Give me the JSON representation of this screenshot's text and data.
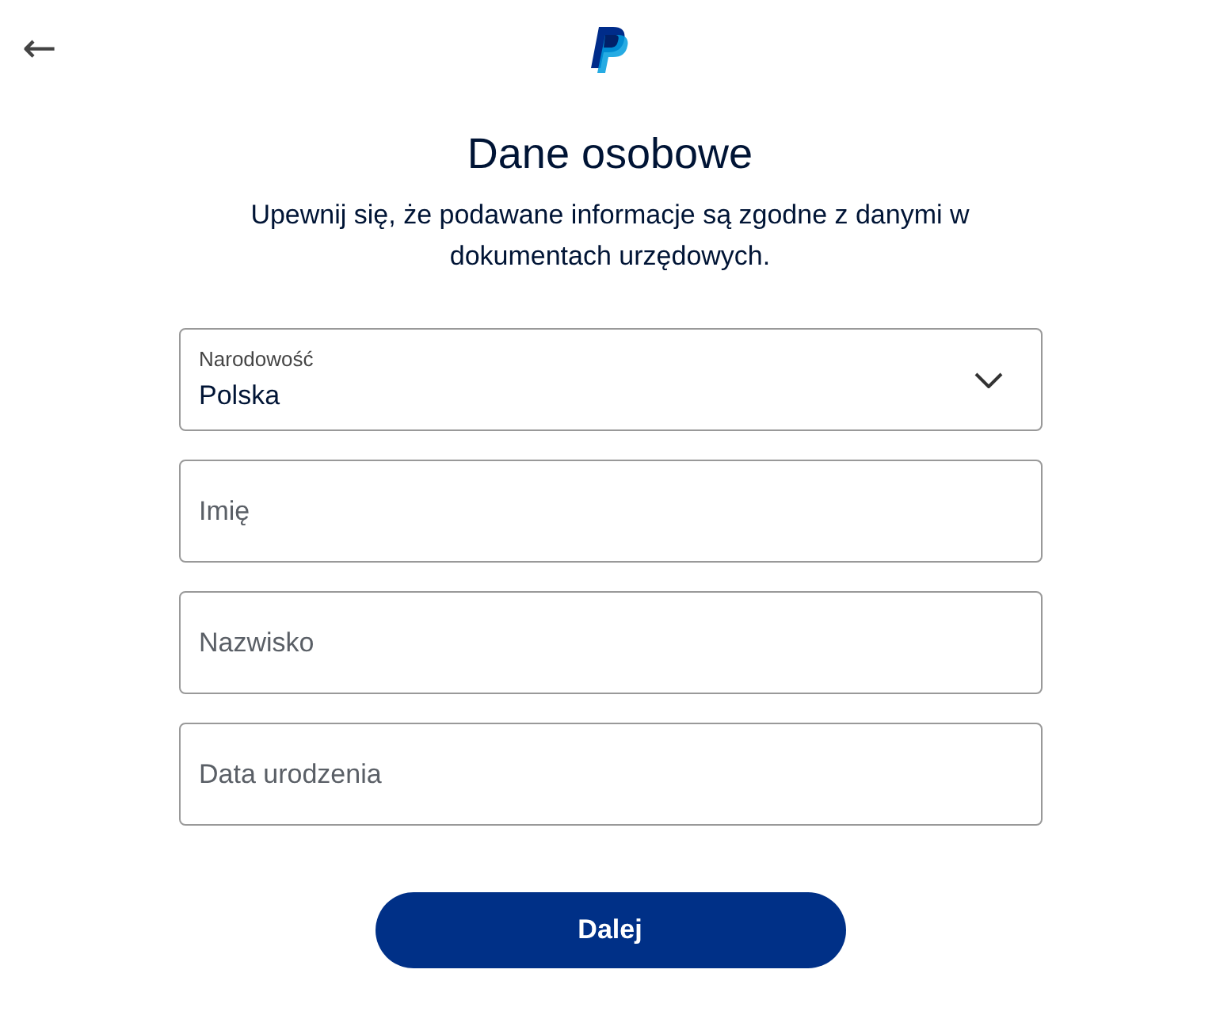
{
  "header": {
    "back": "←"
  },
  "title": "Dane osobowe",
  "subtitle": "Upewnij się, że podawane informacje są zgodne z danymi w dokumentach urzędowych.",
  "fields": [
    {
      "kind": "select",
      "label": "Narodowość",
      "value": "Polska"
    },
    {
      "kind": "text",
      "placeholder": "Imię"
    },
    {
      "kind": "text",
      "placeholder": "Nazwisko"
    },
    {
      "kind": "text",
      "placeholder": "Data urodzenia"
    }
  ],
  "button": "Dalej"
}
